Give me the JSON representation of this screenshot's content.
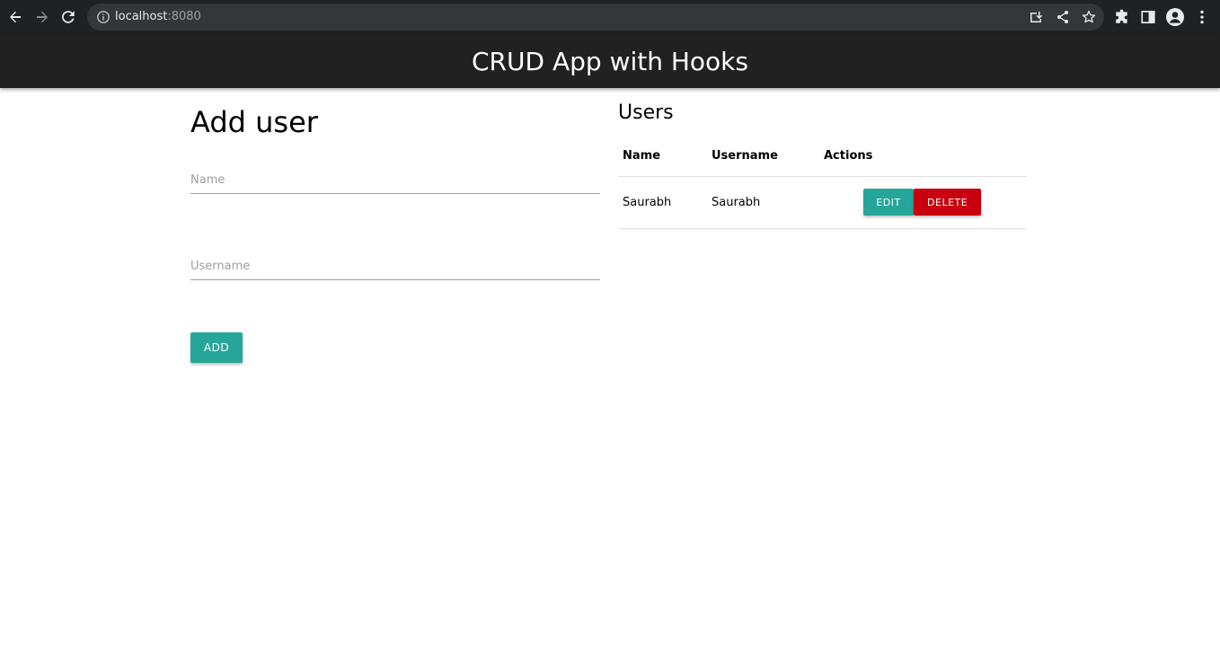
{
  "browser": {
    "url_host": "localhost",
    "url_port": ":8080",
    "icons": {
      "back": "back-arrow-icon",
      "forward": "forward-arrow-icon",
      "reload": "reload-icon",
      "info": "info-icon",
      "install": "install-app-icon",
      "share": "share-icon",
      "bookmark": "star-icon",
      "extensions": "puzzle-icon",
      "side_panel": "side-panel-icon",
      "profile": "profile-icon",
      "menu": "more-vert-icon"
    }
  },
  "header": {
    "title": "CRUD App with Hooks",
    "background": "#212121"
  },
  "add_user": {
    "title": "Add user",
    "name_placeholder": "Name",
    "name_value": "",
    "username_placeholder": "Username",
    "username_value": "",
    "add_label": "ADD"
  },
  "users": {
    "title": "Users",
    "columns": [
      "Name",
      "Username",
      "Actions"
    ],
    "rows": [
      {
        "name": "Saurabh",
        "username": "Saurabh",
        "edit_label": "EDIT",
        "delete_label": "DELETE"
      }
    ]
  },
  "colors": {
    "accent": "#26a69a",
    "danger": "#c8000f"
  }
}
